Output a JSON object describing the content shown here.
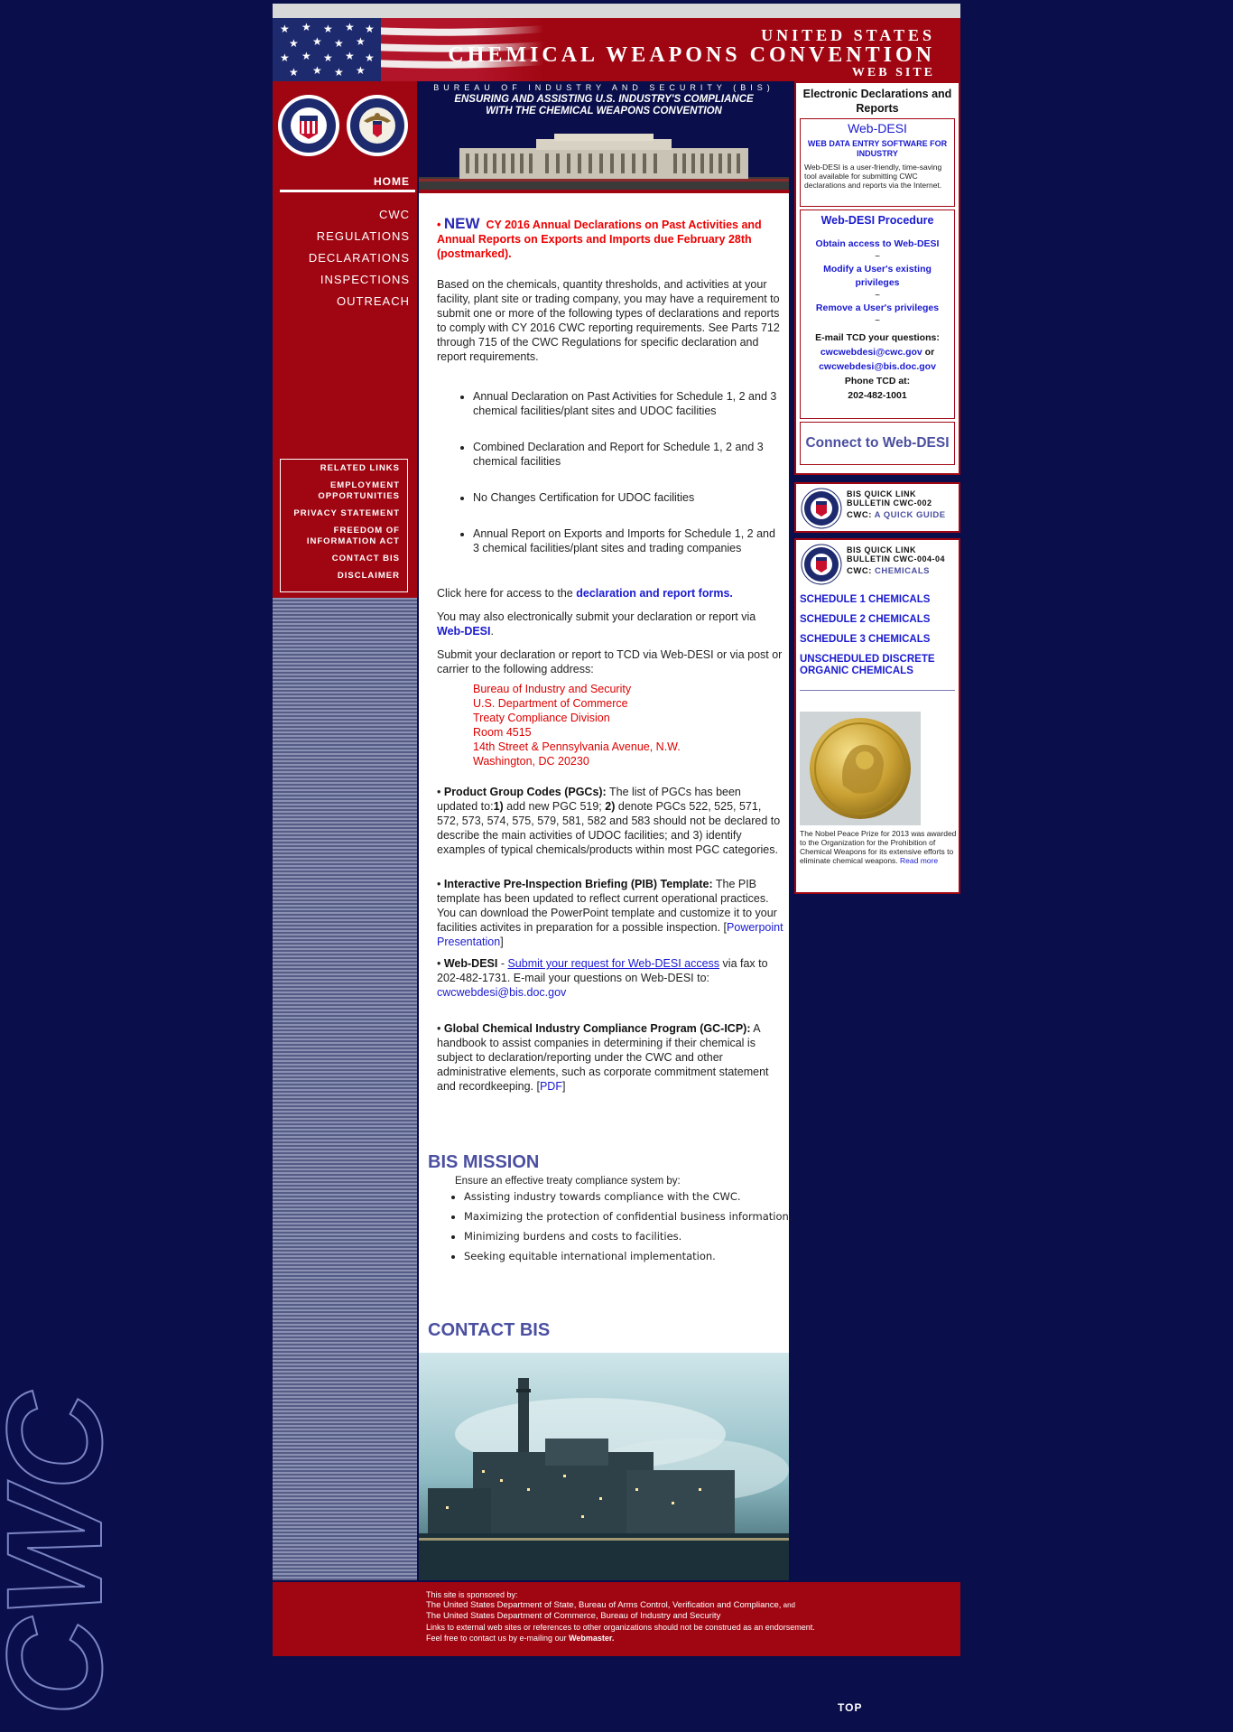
{
  "banner": {
    "line1": "UNITED STATES",
    "line2": "CHEMICAL WEAPONS CONVENTION",
    "line3": "WEB SITE"
  },
  "watermark": "CWC",
  "nav": {
    "home": "HOME",
    "items": [
      "CWC",
      "REGULATIONS",
      "DECLARATIONS",
      "INSPECTIONS",
      "OUTREACH"
    ],
    "sub_items": [
      "RELATED LINKS",
      "EMPLOYMENT",
      "OPPORTUNITIES",
      "PRIVACY STATEMENT",
      "FREEDOM OF",
      "INFORMATION ACT",
      "CONTACT BIS",
      "DISCLAIMER"
    ]
  },
  "center_header": {
    "bureau": "BUREAU OF INDUSTRY AND SECURITY (BIS)",
    "ensuring1": "ENSURING AND ASSISTING U.S. INDUSTRY'S COMPLIANCE",
    "ensuring2": "WITH THE CHEMICAL WEAPONS CONVENTION"
  },
  "content": {
    "new_tag": "NEW",
    "new_text": "CY 2016 Annual Declarations on Past Activities and Annual Reports on Exports and Imports due February 28th (postmarked).",
    "intro": "Based on the chemicals, quantity thresholds, and activities at your facility, plant site or trading company, you may have a requirement to submit one or more of the following types of declarations and reports to comply with CY 2016 CWC reporting requirements. See Parts 712 through 715 of the CWC Regulations for specific declaration and report requirements.",
    "declarations": [
      "Annual Declaration on Past Activities for Schedule 1, 2 and 3 chemical facilities/plant sites and UDOC facilities",
      "Combined Declaration and Report for Schedule 1, 2 and 3 chemical facilities",
      "No Changes Certification for UDOC facilities",
      "Annual Report on Exports and Imports for Schedule 1, 2 and 3 chemical facilities/plant sites and trading companies"
    ],
    "forms_prefix": "Click here for access to the ",
    "forms_link": "declaration and report forms.",
    "electronic_prefix": "You may also electronically submit your declaration or report via ",
    "electronic_link": "Web-DESI",
    "electronic_suffix": ".",
    "submit_text": "Submit your declaration or report to TCD via Web-DESI or via post or carrier to the following address:",
    "address": [
      "Bureau of Industry and Security",
      "U.S. Department of Commerce",
      "Treaty Compliance Division",
      "Room 4515",
      "14th Street & Pennsylvania Avenue, N.W.",
      "Washington, DC 20230"
    ],
    "pgc_title": "Product Group Codes (PGCs):",
    "pgc_text_a": " The list of PGCs has been updated to:",
    "pgc_1": "1)",
    "pgc_text_b": " add new PGC 519; ",
    "pgc_2": "2)",
    "pgc_text_c": " denote PGCs 522, 525, 571, 572, 573, 574, 575, 579, 581, 582 and 583 should not be declared to describe the main activities of UDOC facilities; and 3) identify examples of typical chemicals/products within most PGC categories.",
    "pib_title": "Interactive Pre-Inspection Briefing (PIB) Template:",
    "pib_text": " The PIB template has been updated to reflect current operational practices. You can download the PowerPoint template and customize it to your facilities activites in preparation for a possible inspection.",
    "pib_link_open": "[",
    "pib_link": "Powerpoint Presentation",
    "pib_link_close": "]",
    "webdesi_title": "Web-DESI",
    "webdesi_dash": " - ",
    "webdesi_link": "Submit your request for Web-DESI access",
    "webdesi_text": " via fax to 202-482-1731. E-mail your questions on Web-DESI to: ",
    "webdesi_email": "cwcwebdesi@bis.doc.gov",
    "gcicp_title": "Global Chemical Industry Compliance Program (GC-ICP):",
    "gcicp_text": " A handbook to assist companies in determining if their chemical is subject to declaration/reporting under the CWC and other administrative elements, such as corporate commitment statement and recordkeeping. [",
    "gcicp_link": "PDF",
    "gcicp_close": "]"
  },
  "mission": {
    "heading": "BIS MISSION",
    "intro": "Ensure an effective treaty compliance system by:",
    "items": [
      "Assisting industry towards compliance with the CWC.",
      "Maximizing the protection of confidential business information.",
      "Minimizing burdens and costs to facilities.",
      "Seeking equitable international implementation."
    ],
    "contact_heading": "CONTACT BIS"
  },
  "right": {
    "edr_title": "Electronic Declarations and Reports",
    "webdesi_heading": "Web-DESI",
    "webdesi_sub": "WEB DATA ENTRY SOFTWARE FOR INDUSTRY",
    "webdesi_desc": "Web-DESI is a user-friendly, time-saving tool available for submitting CWC declarations and reports via the Internet.",
    "procedure_heading": "Web-DESI Procedure",
    "procedure_links": [
      "Obtain access to Web-DESI",
      "Modify a User's existing privileges",
      "Remove a User's privileges"
    ],
    "tilde": "~",
    "email_label": "E-mail TCD your questions:",
    "email1": "cwcwebdesi@cwc.gov",
    "email_or": " or",
    "email2": "cwcwebdesi@bis.doc.gov",
    "phone_label": "Phone TCD at:",
    "phone_number": "202-482-1001",
    "connect": "Connect to Web-DESI",
    "quicklink1": {
      "line1": "BIS QUICK LINK",
      "line2": "BULLETIN CWC-002",
      "prefix": "CWC: ",
      "link": "A QUICK GUIDE"
    },
    "quicklink2": {
      "line1": "BIS QUICK LINK",
      "line2": "BULLETIN CWC-004-04",
      "prefix": "CWC: ",
      "link": "CHEMICALS"
    },
    "chemical_links": [
      "SCHEDULE 1 CHEMICALS",
      "SCHEDULE 2 CHEMICALS",
      "SCHEDULE 3 CHEMICALS",
      "UNSCHEDULED DISCRETE ORGANIC CHEMICALS"
    ],
    "nobel_text": "The Nobel Peace Prize for 2013 was awarded to the Organization for the Prohibition of Chemical Weapons for its extensive efforts to eliminate chemical weapons. ",
    "nobel_more": "Read more"
  },
  "footer": {
    "l1": "This site is sponsored by:",
    "l2a": "The United States Department of State, Bureau of Arms Control, Verification and Compliance,",
    "l2b": " and",
    "l3": "The United States Department of Commerce, Bureau of Industry and Security",
    "l4": "Links to external web sites or references to other organizations should not be construed as an endorsement.",
    "l5": "Feel free to contact us by e-mailing our ",
    "webmaster": "Webmaster."
  },
  "top_link": "TOP",
  "colors": {
    "background": "#0a0e4a",
    "brand_red": "#a00612",
    "link_blue": "#1a1ad0",
    "heading_purple": "#4b4fa0",
    "alert_red": "#e00000"
  }
}
